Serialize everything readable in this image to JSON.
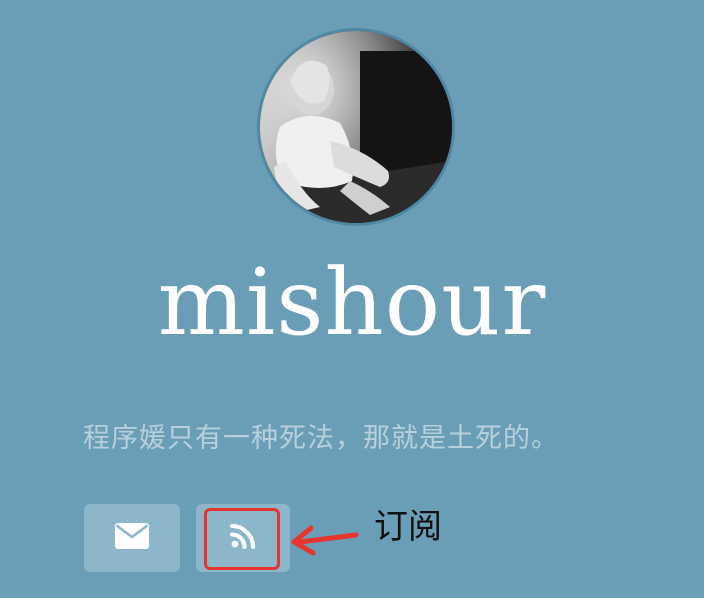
{
  "profile": {
    "name": "mishour",
    "tagline": "程序媛只有一种死法，那就是土死的。"
  },
  "social": {
    "email_icon": "envelope-icon",
    "rss_icon": "rss-icon"
  },
  "annotation": {
    "label": "订阅",
    "color": "#e8342e"
  },
  "theme": {
    "background": "#6a9eb7",
    "button_background": "#8cb6ca",
    "tagline_color": "#b8d0dc"
  }
}
